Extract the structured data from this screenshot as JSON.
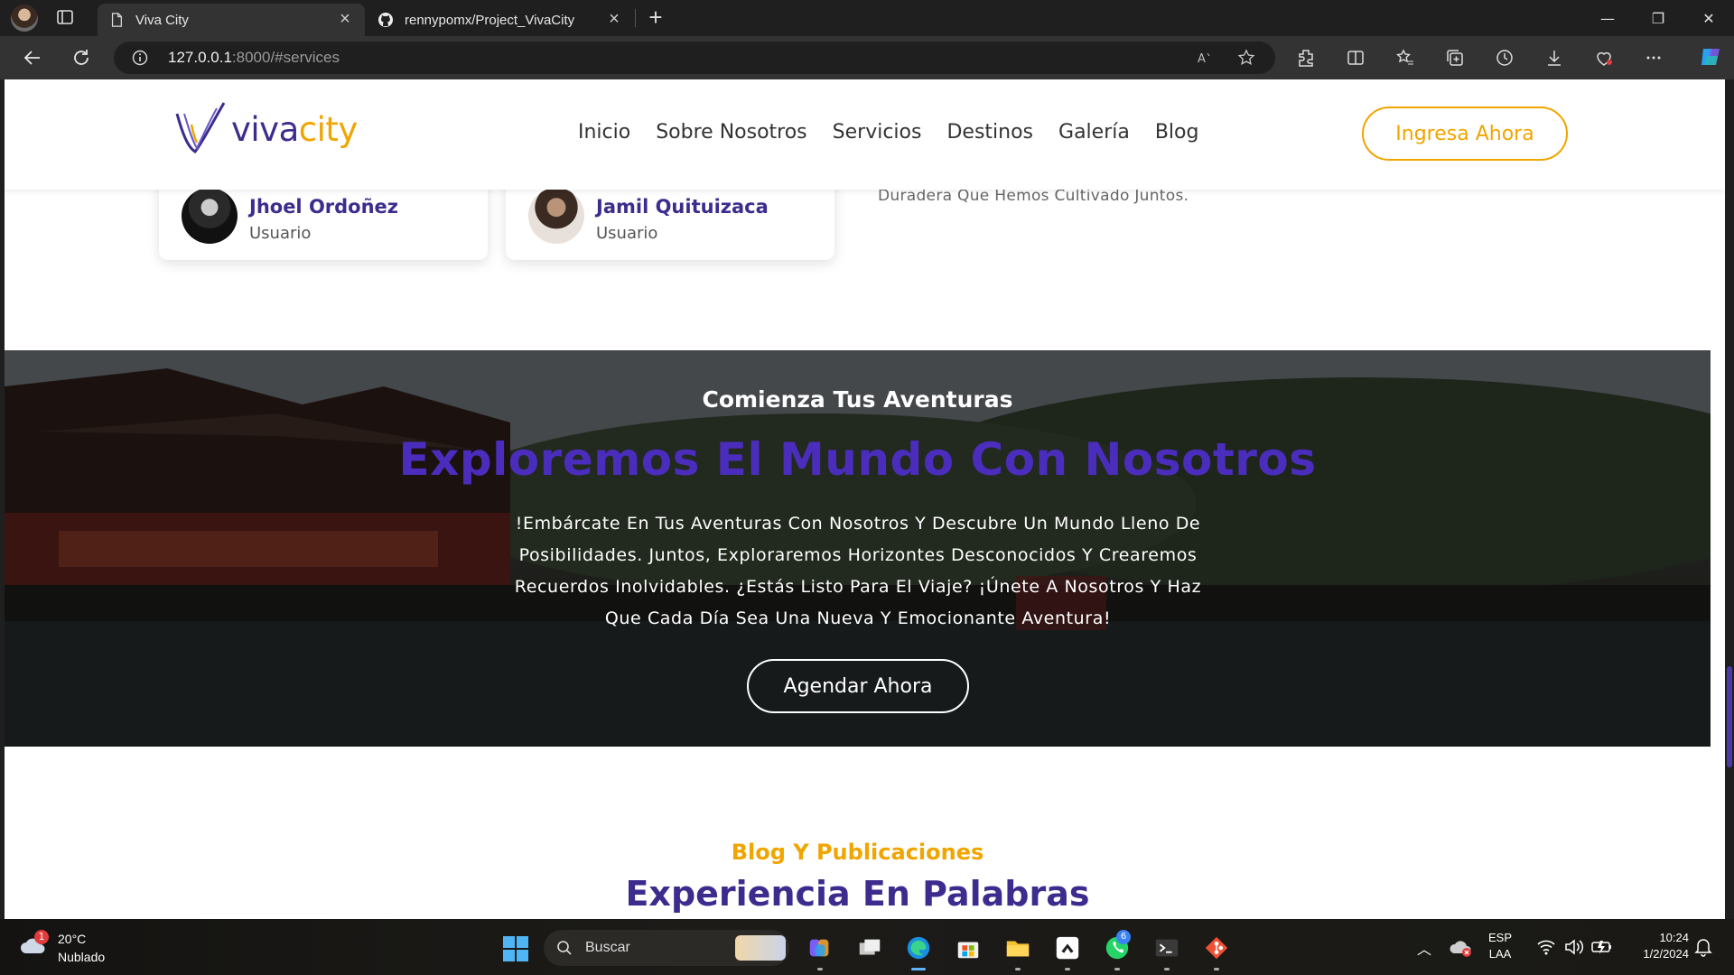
{
  "browser": {
    "tabs": [
      {
        "title": "Viva City",
        "active": true
      },
      {
        "title": "rennypomx/Project_VivaCity",
        "active": false
      }
    ],
    "address": {
      "host": "127.0.0.1",
      "rest": ":8000/#services"
    }
  },
  "site": {
    "logo": {
      "part1": "viva",
      "part2": "city"
    },
    "nav": [
      "Inicio",
      "Sobre Nosotros",
      "Servicios",
      "Destinos",
      "Galería",
      "Blog"
    ],
    "cta": "Ingresa Ahora",
    "testimonials": [
      {
        "name": "Jhoel Ordoñez",
        "role": "Usuario"
      },
      {
        "name": "Jamil Quituizaca",
        "role": "Usuario"
      }
    ],
    "testimonial_tail": "Duradera Que Hemos Cultivado Juntos.",
    "banner": {
      "eyebrow": "Comienza Tus Aventuras",
      "headline": "Exploremos El Mundo Con Nosotros",
      "body": "!Embárcate En Tus Aventuras Con Nosotros Y Descubre Un Mundo Lleno De Posibilidades. Juntos, Exploraremos Horizontes Desconocidos Y Crearemos Recuerdos Inolvidables. ¿Estás Listo Para El Viaje? ¡Únete A Nosotros Y Haz Que Cada Día Sea Una Nueva Y Emocionante Aventura!",
      "button": "Agendar Ahora"
    },
    "blog": {
      "eyebrow": "Blog Y Publicaciones",
      "title": "Experiencia En Palabras"
    },
    "colors": {
      "primary": "#3d2c8d",
      "accent": "#f0a500"
    }
  },
  "taskbar": {
    "weather": {
      "temp": "20°C",
      "desc": "Nublado",
      "alerts": "1"
    },
    "search_label": "Buscar",
    "whatsapp_badge": "6",
    "lang": {
      "line1": "ESP",
      "line2": "LAA"
    },
    "clock": {
      "time": "10:24",
      "date": "1/2/2024"
    }
  }
}
